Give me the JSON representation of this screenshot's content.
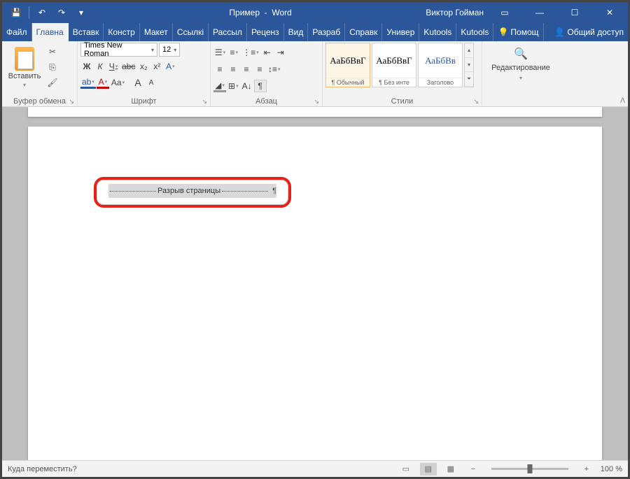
{
  "title": {
    "doc": "Пример",
    "app": "Word",
    "user": "Виктор Гойман"
  },
  "qat": {
    "save": "💾",
    "undo": "↶",
    "redo": "↷"
  },
  "tabs": [
    "Файл",
    "Главна",
    "Вставк",
    "Констр",
    "Макет",
    "Ссылкі",
    "Рассыл",
    "Реценз",
    "Вид",
    "Разраб",
    "Справк",
    "Универ",
    "Kutools",
    "Kutools"
  ],
  "tell": "Помощ",
  "share": "Общий доступ",
  "clipboard": {
    "paste": "Вставить",
    "group": "Буфер обмена"
  },
  "font": {
    "name": "Times New Roman",
    "size": "12",
    "group": "Шрифт",
    "buttons": {
      "bold": "Ж",
      "italic": "К",
      "under": "Ч",
      "strike": "abc",
      "sub": "x₂",
      "sup": "x²",
      "clear": "A",
      "effects": "A",
      "color": "A",
      "highlight": "ab",
      "case": "Aa",
      "grow": "A",
      "shrink": "A"
    }
  },
  "para": {
    "group": "Абзац"
  },
  "styles": {
    "group": "Стили",
    "items": [
      {
        "prev": "АаБбВвГ",
        "name": "¶ Обычный"
      },
      {
        "prev": "АаБбВвГ",
        "name": "¶ Без инте"
      },
      {
        "prev": "АаБбВв",
        "name": "Заголово"
      }
    ]
  },
  "editing": {
    "label": "Редактирование"
  },
  "pagebreak_text": "Разрыв страницы",
  "status": {
    "left": "Куда переместить?",
    "zoom": "100 %"
  }
}
